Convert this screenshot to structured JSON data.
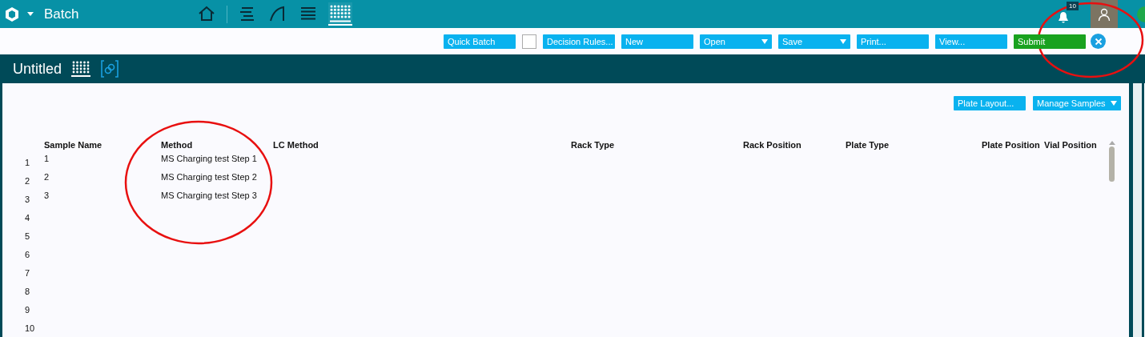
{
  "app": {
    "title": "Batch"
  },
  "nav_icons": [
    {
      "kind": "home",
      "selected": false
    },
    {
      "kind": "tune",
      "selected": false
    },
    {
      "kind": "curve",
      "selected": false
    },
    {
      "kind": "list",
      "selected": false
    },
    {
      "kind": "plate",
      "selected": true
    }
  ],
  "notifications": {
    "count": "10"
  },
  "toolbar": [
    {
      "kind": "button",
      "label": "Quick Batch"
    },
    {
      "kind": "checkbox",
      "checked": false
    },
    {
      "kind": "button",
      "label": "Decision Rules..."
    },
    {
      "kind": "button",
      "label": "New"
    },
    {
      "kind": "dropdown",
      "label": "Open"
    },
    {
      "kind": "dropdown",
      "label": "Save"
    },
    {
      "kind": "button",
      "label": "Print..."
    },
    {
      "kind": "button",
      "label": "View..."
    },
    {
      "kind": "submit",
      "label": "Submit"
    },
    {
      "kind": "close"
    }
  ],
  "document": {
    "title": "Untitled"
  },
  "panel_buttons": [
    {
      "kind": "button",
      "label": "Plate Layout..."
    },
    {
      "kind": "dropdown",
      "label": "Manage Samples"
    }
  ],
  "table": {
    "columns": [
      "Sample Name",
      "Method",
      "LC Method",
      "Rack Type",
      "Rack Position",
      "Plate Type",
      "Plate Position",
      "Vial Position"
    ],
    "rows": [
      {
        "number": "1",
        "sample_name": "1",
        "method": "MS Charging test Step 1"
      },
      {
        "number": "2",
        "sample_name": "2",
        "method": "MS Charging test Step 2"
      },
      {
        "number": "3",
        "sample_name": "3",
        "method": "MS Charging test Step 3"
      },
      {
        "number": "4"
      },
      {
        "number": "5"
      },
      {
        "number": "6"
      },
      {
        "number": "7"
      },
      {
        "number": "8"
      },
      {
        "number": "9"
      },
      {
        "number": "10"
      }
    ]
  }
}
